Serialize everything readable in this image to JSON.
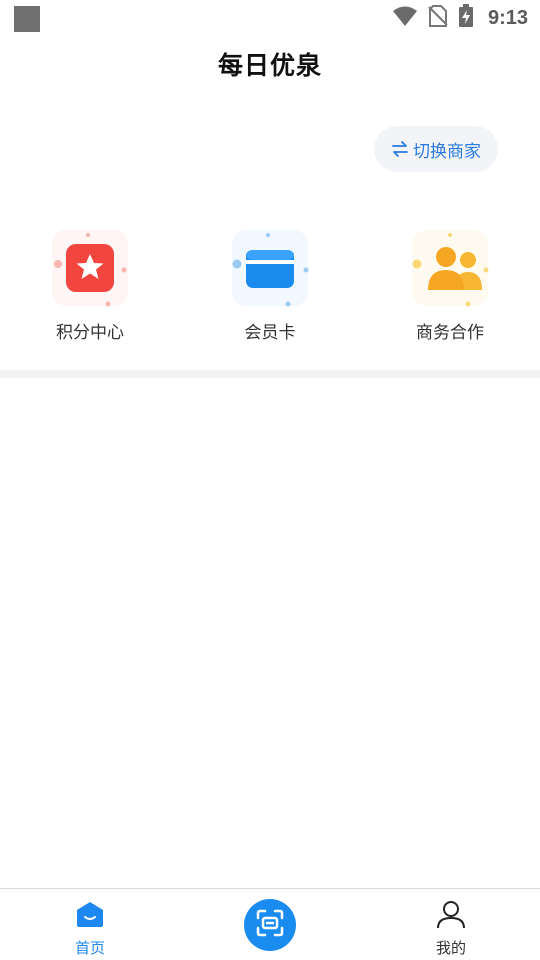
{
  "status_bar": {
    "time": "9:13",
    "icons": [
      "wifi-icon",
      "no-sim-icon",
      "battery-charging-icon"
    ]
  },
  "header": {
    "title": "每日优泉"
  },
  "switch_merchant": {
    "label": "切换商家",
    "icon": "swap-icon",
    "color": "#2a7ae2"
  },
  "features": [
    {
      "label": "积分中心",
      "icon": "star-icon",
      "color": "#f2453d"
    },
    {
      "label": "会员卡",
      "icon": "card-icon",
      "color": "#1a8cf0"
    },
    {
      "label": "商务合作",
      "icon": "people-icon",
      "color": "#f5a623"
    }
  ],
  "bottom_nav": {
    "items": [
      {
        "label": "首页",
        "icon": "home-icon",
        "active": true
      },
      {
        "label": "",
        "icon": "scan-icon"
      },
      {
        "label": "我的",
        "icon": "user-icon",
        "active": false
      }
    ],
    "active_color": "#1e87f0"
  }
}
